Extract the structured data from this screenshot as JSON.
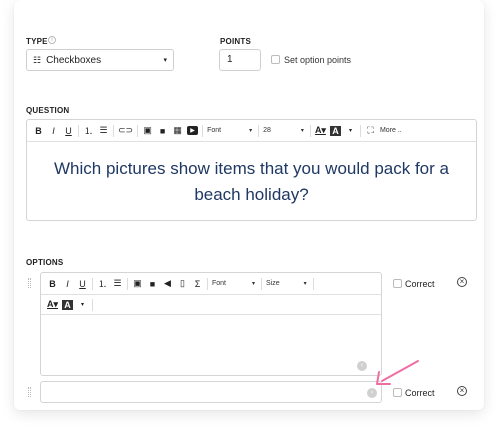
{
  "type_section": {
    "label": "TYPE",
    "info_icon": "i",
    "selected_icon": "checkbox-list-icon",
    "selected_value": "Checkboxes",
    "caret": "▾"
  },
  "points_section": {
    "label": "POINTS",
    "value": "1",
    "set_option_points_label": "Set option points"
  },
  "question_section": {
    "label": "QUESTION",
    "toolbar": {
      "bold": "B",
      "italic": "I",
      "underline": "U",
      "font_label": "Font",
      "size_value": "28",
      "more_label": "More ..",
      "caret": "▾"
    },
    "text": "Which pictures show items that you would pack for a beach holiday?"
  },
  "options_section": {
    "label": "OPTIONS",
    "toolbar": {
      "bold": "B",
      "italic": "I",
      "underline": "U",
      "sigma": "Σ",
      "font_label": "Font",
      "size_label": "Size",
      "caret": "▾"
    },
    "options": [
      {
        "correct_label": "Correct"
      },
      {
        "correct_label": "Correct"
      }
    ]
  },
  "colors": {
    "question_text": "#1f3864",
    "annotation_arrow": "#ee6ea3"
  }
}
